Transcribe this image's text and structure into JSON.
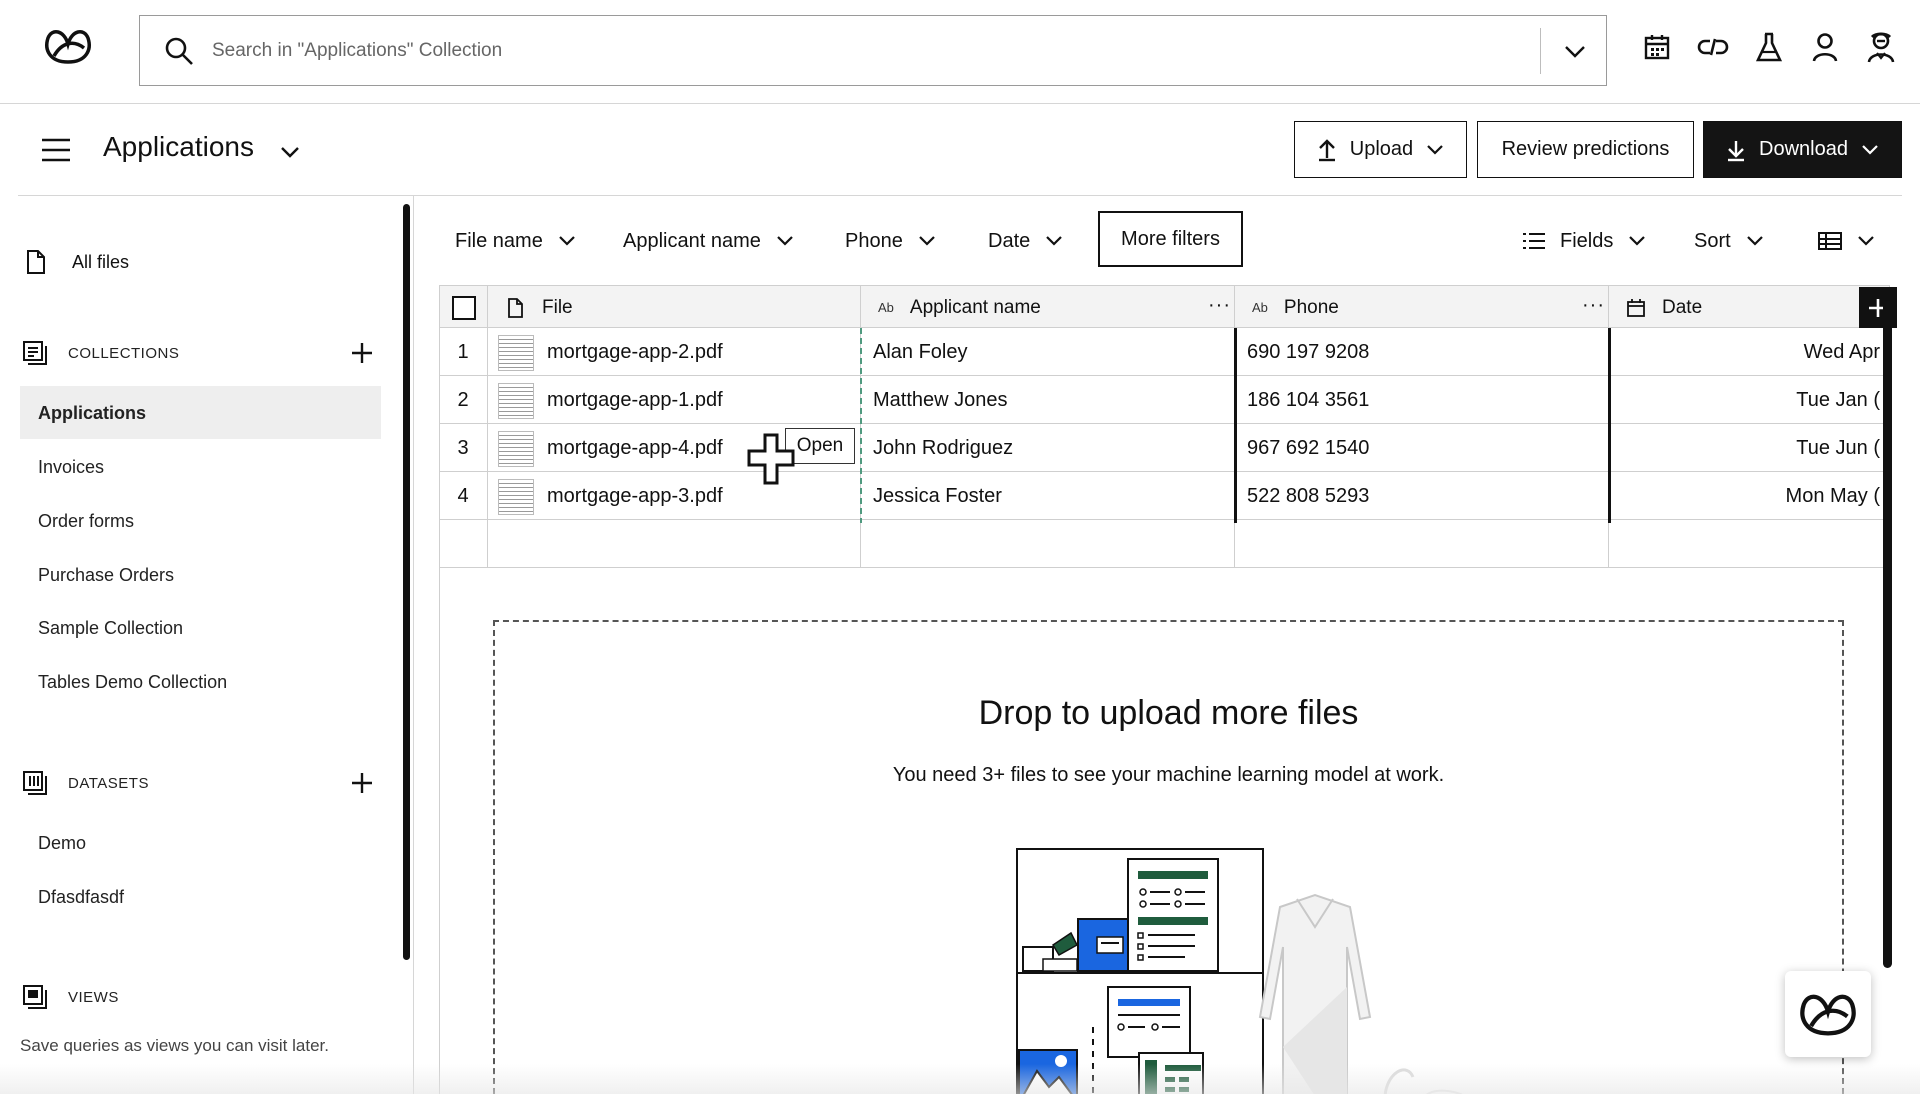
{
  "search": {
    "placeholder": "Search in \"Applications\" Collection"
  },
  "top_icons": [
    "calendar-icon",
    "link-icon",
    "flask-icon",
    "user-icon",
    "agent-icon"
  ],
  "header": {
    "title": "Applications",
    "upload_label": "Upload",
    "review_label": "Review predictions",
    "download_label": "Download"
  },
  "sidebar": {
    "all_files": "All files",
    "collections_label": "COLLECTIONS",
    "collections": [
      "Applications",
      "Invoices",
      "Order forms",
      "Purchase Orders",
      "Sample Collection",
      "Tables Demo Collection"
    ],
    "active_collection": "Applications",
    "datasets_label": "DATASETS",
    "datasets": [
      "Demo",
      "Dfasdfasdf"
    ],
    "views_label": "VIEWS",
    "views_hint": "Save queries as views you can visit later."
  },
  "filters": {
    "file_name": "File name",
    "applicant_name": "Applicant name",
    "phone": "Phone",
    "date": "Date",
    "more_filters": "More filters",
    "fields": "Fields",
    "sort": "Sort"
  },
  "table": {
    "columns": {
      "file": "File",
      "applicant_type": "Ab",
      "applicant": "Applicant name",
      "phone_type": "Ab",
      "phone": "Phone",
      "date": "Date"
    },
    "rows": [
      {
        "num": "1",
        "file": "mortgage-app-2.pdf",
        "applicant": "Alan Foley",
        "phone": "690 197 9208",
        "date": "Wed Apr"
      },
      {
        "num": "2",
        "file": "mortgage-app-1.pdf",
        "applicant": "Matthew Jones",
        "phone": "186 104 3561",
        "date": "Tue Jan ("
      },
      {
        "num": "3",
        "file": "mortgage-app-4.pdf",
        "applicant": "John Rodriguez",
        "phone": "967 692 1540",
        "date": "Tue Jun ("
      },
      {
        "num": "4",
        "file": "mortgage-app-3.pdf",
        "applicant": "Jessica Foster",
        "phone": "522 808 5293",
        "date": "Mon May ("
      }
    ],
    "open_tooltip": "Open"
  },
  "dropzone": {
    "title": "Drop to upload more files",
    "subtitle": "You need 3+ files to see your machine learning model at work."
  },
  "colors": {
    "accent_green": "#1f5c3d",
    "accent_blue": "#1a66e0",
    "dark": "#141414"
  }
}
